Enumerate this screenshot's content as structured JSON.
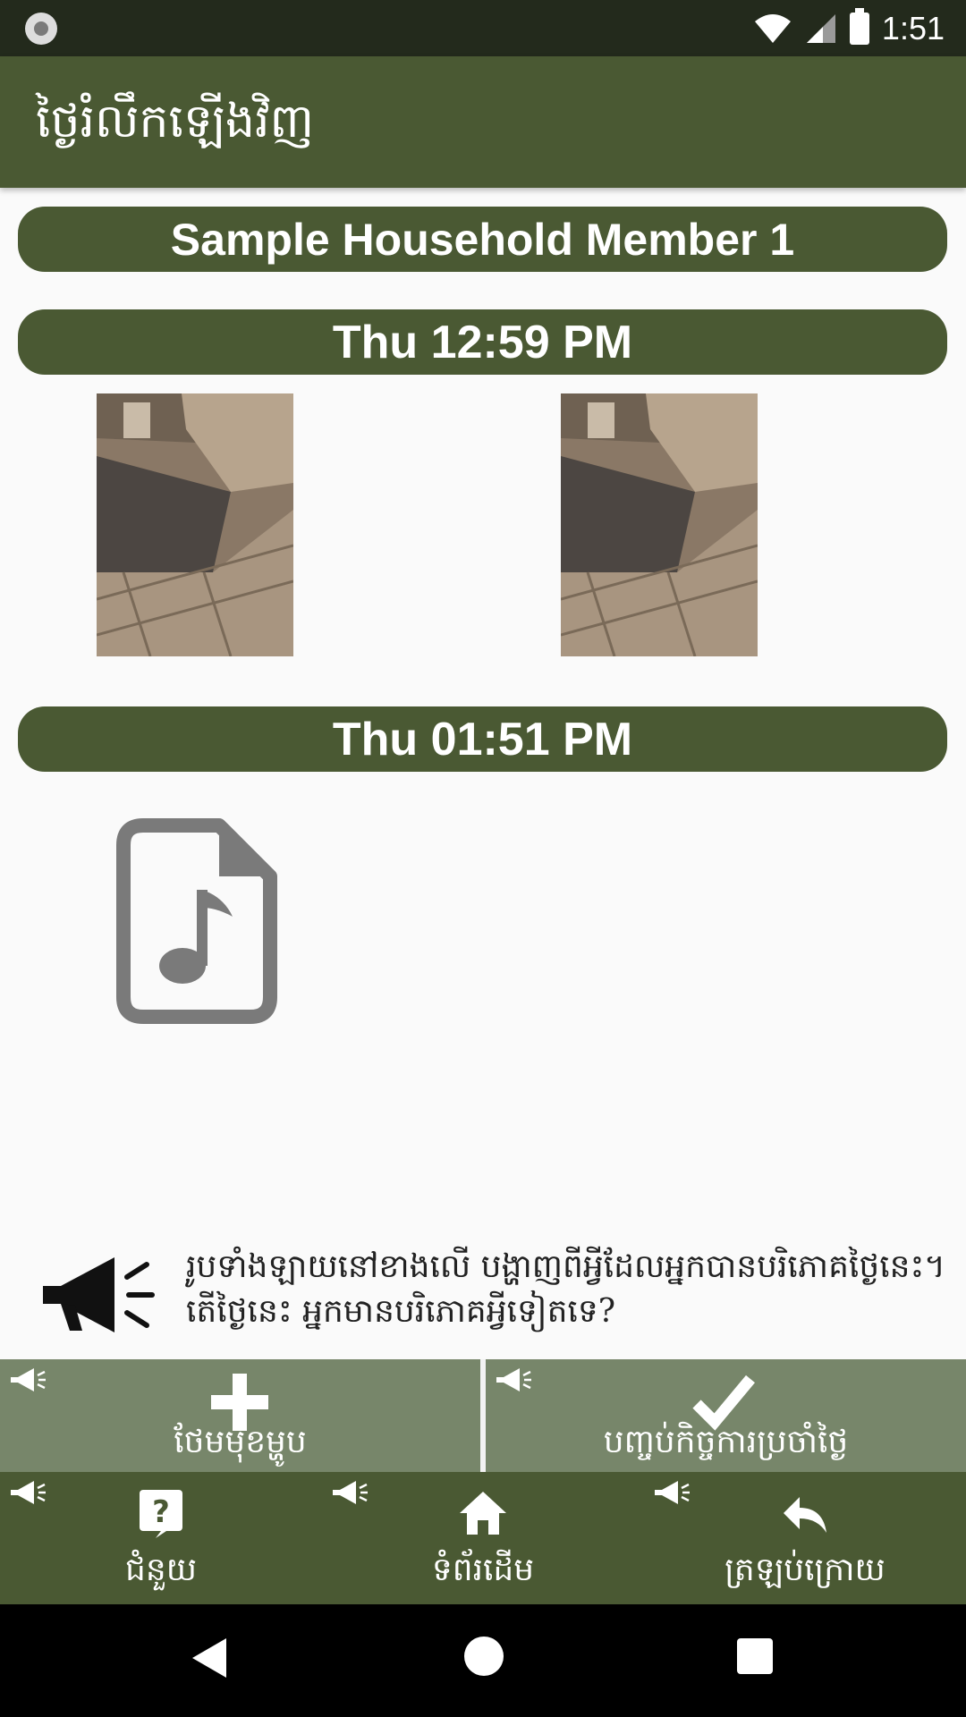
{
  "status_bar": {
    "time": "1:51"
  },
  "app_bar": {
    "title": "ថ្ងៃរំលឹកឡើងវិញ"
  },
  "member": {
    "name": "Sample Household Member 1"
  },
  "entries": [
    {
      "time_label": "Thu 12:59 PM",
      "media": [
        "photo",
        "photo"
      ]
    },
    {
      "time_label": "Thu 01:51 PM",
      "media": [
        "audio-file"
      ]
    }
  ],
  "prompt": {
    "icon": "megaphone-icon",
    "text": "រូបទាំងឡាយនៅខាងលើ បង្ហាញពីអ្វីដែលអ្នកបានបរិភោគថ្ងៃនេះ។ តើថ្ងៃនេះ អ្នកមានបរិភោគអ្វីទៀតទេ?"
  },
  "actions": {
    "add_label": "ថែមមុខម្ហូប",
    "done_label": "បញ្ចប់កិច្ចការប្រចាំថ្ងៃ"
  },
  "bottom_nav": {
    "help_label": "ជំនួយ",
    "home_label": "ទំព័រដើម",
    "back_label": "ត្រឡប់ក្រោយ"
  },
  "colors": {
    "primary": "#4a5933",
    "action_bar": "#77866a",
    "status_bar": "#232a1c"
  }
}
